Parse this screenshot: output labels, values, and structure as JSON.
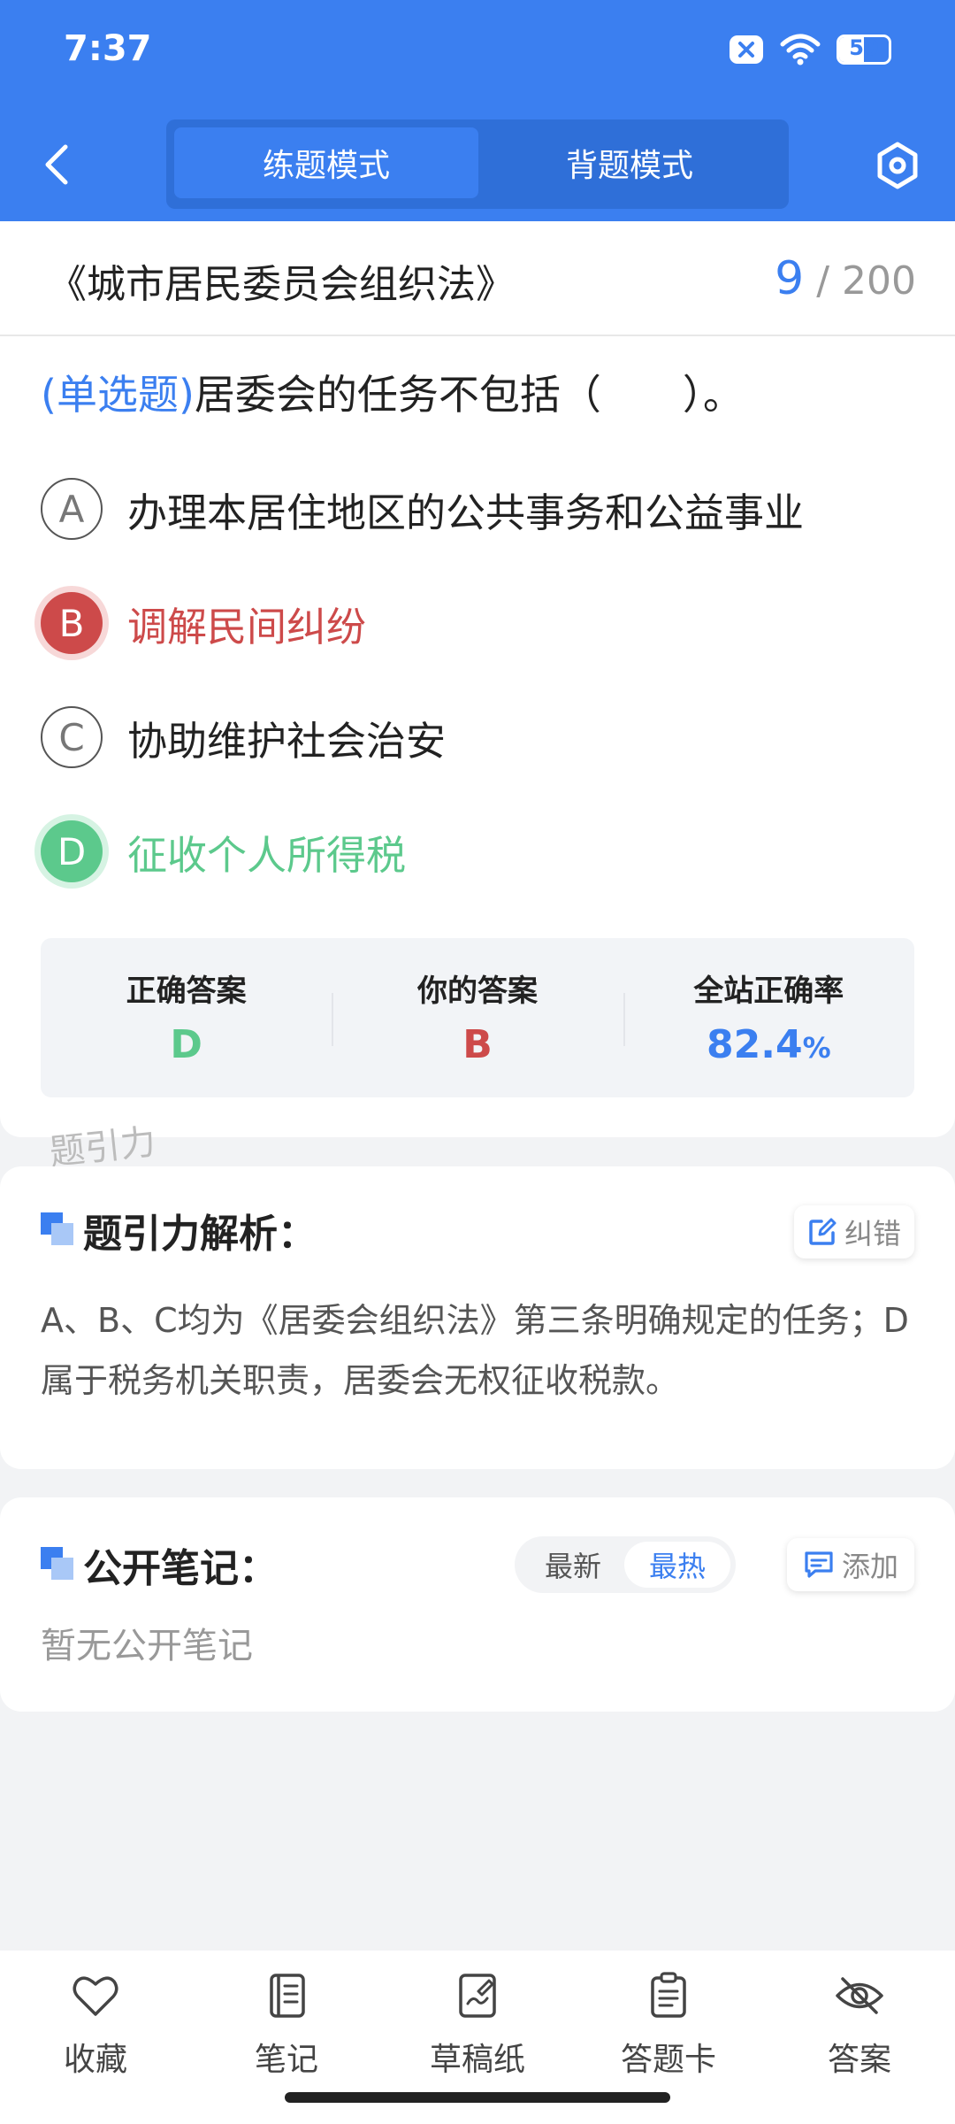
{
  "status_bar": {
    "time": "7:37",
    "battery": "50",
    "battery_level": 0.5
  },
  "header": {
    "modes": [
      {
        "label": "练题模式",
        "active": true
      },
      {
        "label": "背题模式",
        "active": false
      }
    ]
  },
  "question_card": {
    "book_title": "《城市居民委员会组织法》",
    "current": "9",
    "total": "/ 200",
    "type": "(单选题)",
    "question": "居委会的任务不包括（　　）。",
    "options": [
      {
        "letter": "A",
        "text": "办理本居住地区的公共事务和公益事业",
        "state": "normal"
      },
      {
        "letter": "B",
        "text": "调解民间纠纷",
        "state": "wrong"
      },
      {
        "letter": "C",
        "text": "协助维护社会治安",
        "state": "normal"
      },
      {
        "letter": "D",
        "text": "征收个人所得税",
        "state": "correct"
      }
    ],
    "stats": {
      "correct_label": "正确答案",
      "correct_value": "D",
      "yours_label": "你的答案",
      "yours_value": "B",
      "rate_label": "全站正确率",
      "rate_value": "82.4",
      "rate_unit": "%"
    }
  },
  "watermark": "题引力",
  "analysis": {
    "title": "题引力解析：",
    "report_label": "纠错",
    "text": "A、B、C均为《居委会组织法》第三条明确规定的任务；D属于税务机关职责，居委会无权征收税款。"
  },
  "notes": {
    "title": "公开笔记：",
    "sort_options": [
      "最新",
      "最热"
    ],
    "sort_active": "最热",
    "add_label": "添加",
    "empty_text": "暂无公开笔记"
  },
  "bottom_nav": [
    {
      "label": "收藏",
      "icon": "heart-icon"
    },
    {
      "label": "笔记",
      "icon": "notebook-icon"
    },
    {
      "label": "草稿纸",
      "icon": "draft-icon"
    },
    {
      "label": "答题卡",
      "icon": "answer-sheet-icon"
    },
    {
      "label": "答案",
      "icon": "eye-off-icon"
    }
  ],
  "colors": {
    "primary": "#3b7ff0",
    "correct": "#5cc98c",
    "wrong": "#cd4a4a"
  }
}
